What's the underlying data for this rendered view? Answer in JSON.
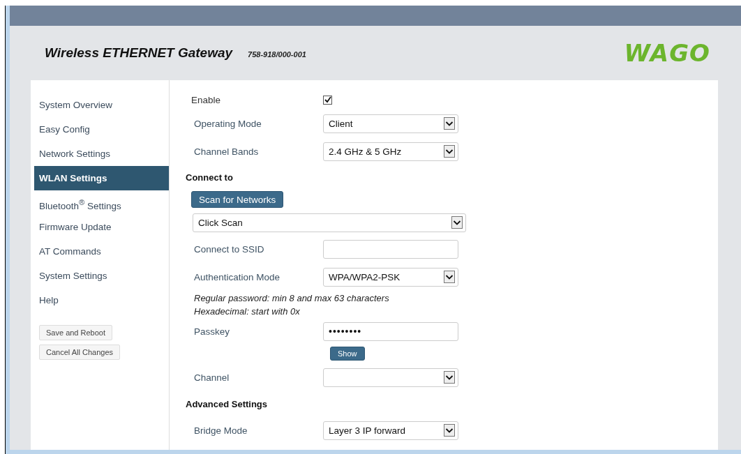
{
  "header": {
    "title": "Wireless ETHERNET Gateway",
    "model": "758-918/000-001",
    "logo": "WAGO"
  },
  "sidebar": {
    "items": [
      {
        "label": "System Overview",
        "selected": false
      },
      {
        "label": "Easy Config",
        "selected": false
      },
      {
        "label": "Network Settings",
        "selected": false
      },
      {
        "label": "WLAN Settings",
        "selected": true
      },
      {
        "label": "Bluetooth$^{®}$ Settings",
        "selected": false
      },
      {
        "label": "Firmware Update",
        "selected": false
      },
      {
        "label": "AT Commands",
        "selected": false
      },
      {
        "label": "System Settings",
        "selected": false
      },
      {
        "label": "Help",
        "selected": false
      }
    ],
    "buttons": [
      "Save and Reboot",
      "Cancel All Changes"
    ]
  },
  "form": [
    {
      "kind": "checkbox",
      "label": "Enable",
      "checked": true
    },
    {
      "kind": "select",
      "label": "Operating Mode",
      "value": "Client"
    },
    {
      "kind": "select",
      "label": "Channel Bands",
      "value": "2.4 GHz & 5 GHz"
    },
    {
      "kind": "heading",
      "text": "Connect to"
    },
    {
      "kind": "button",
      "text": "Scan for Networks"
    },
    {
      "kind": "wide-select",
      "value": "Click Scan"
    },
    {
      "kind": "text",
      "label": "Connect to SSID"
    },
    {
      "kind": "select",
      "label": "Authentication Mode",
      "value": "WPA/WPA2-PSK"
    },
    {
      "kind": "hint",
      "lines": [
        "Regular password: min 8 and max 63 characters",
        "Hexadecimal: start with 0x"
      ]
    },
    {
      "kind": "password",
      "label": "Passkey",
      "value": "••••••••"
    },
    {
      "kind": "small-button",
      "text": "Show"
    },
    {
      "kind": "select",
      "label": "Channel"
    },
    {
      "kind": "heading",
      "text": "Advanced Settings"
    },
    {
      "kind": "select",
      "label": "Bridge Mode",
      "value": "Layer 3 IP forward"
    }
  ]
}
